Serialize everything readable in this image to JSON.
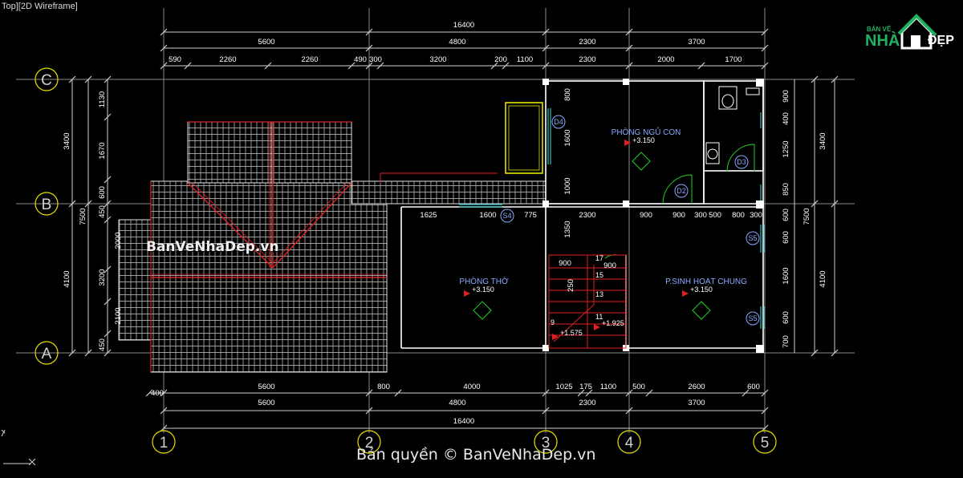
{
  "view_label": "Top][2D Wireframe]",
  "colors": {
    "dim": "#d0d0d0",
    "wall": "#ffffff",
    "axis": "#8a8a8a",
    "red": "#e02020",
    "green": "#20d020",
    "yellow": "#e8e000",
    "cyan": "#30c0c0",
    "room": "#8aa8ff"
  },
  "top_dims": {
    "overall": "16400",
    "segments": [
      "5600",
      "4800",
      "2300",
      "3700"
    ],
    "details": [
      "590",
      "2260",
      "2260",
      "490",
      "300",
      "3200",
      "200",
      "1100",
      "2300",
      "2000",
      "1700"
    ]
  },
  "bottom_dims": {
    "overall": "16400",
    "segments": [
      "5600",
      "4800",
      "2300",
      "3700"
    ],
    "details": [
      "400",
      "5600",
      "800",
      "4000",
      "1025",
      "175",
      "1100",
      "500",
      "2600",
      "600"
    ],
    "row2_segment": "2300"
  },
  "left_dims": {
    "overall": "7500",
    "segments": [
      "3400",
      "4100"
    ],
    "details": [
      "1130",
      "1670",
      "600",
      "450",
      "2000",
      "3200",
      "2100",
      "450"
    ]
  },
  "right_dims": {
    "overall": "7500",
    "segments": [
      "3400",
      "4100"
    ],
    "details": [
      "900",
      "400",
      "1250",
      "850",
      "600",
      "600",
      "1600",
      "600",
      "700"
    ]
  },
  "inner_dims": [
    "800",
    "1600",
    "1000",
    "1350",
    "1625",
    "1600",
    "775",
    "2300",
    "900",
    "900",
    "300",
    "500",
    "800",
    "300",
    "900",
    "900",
    "250"
  ],
  "grid_rows": [
    "C",
    "B",
    "A"
  ],
  "grid_cols": [
    "1",
    "2",
    "3",
    "4",
    "5"
  ],
  "rooms": [
    {
      "name": "PHÒNG NGỦ CON",
      "level": "+3.150"
    },
    {
      "name": "PHÒNG THỜ",
      "level": "+3.150"
    },
    {
      "name": "P.SINH HOẠT CHUNG",
      "level": "+3.150"
    }
  ],
  "stair": {
    "steps": [
      "17",
      "15",
      "13",
      "11",
      "9"
    ],
    "levels": [
      "+1.925",
      "+1.575"
    ]
  },
  "tags": [
    "D4",
    "D2",
    "D3",
    "S4",
    "S5",
    "S5"
  ],
  "watermark_mid": "BanVeNhaDep.vn",
  "copyright": "Bản quyền © BanVeNhaDep.vn",
  "logo": {
    "top": "BẢN VẼ",
    "nha": "NHÀ",
    "dep": "ĐẸP"
  }
}
